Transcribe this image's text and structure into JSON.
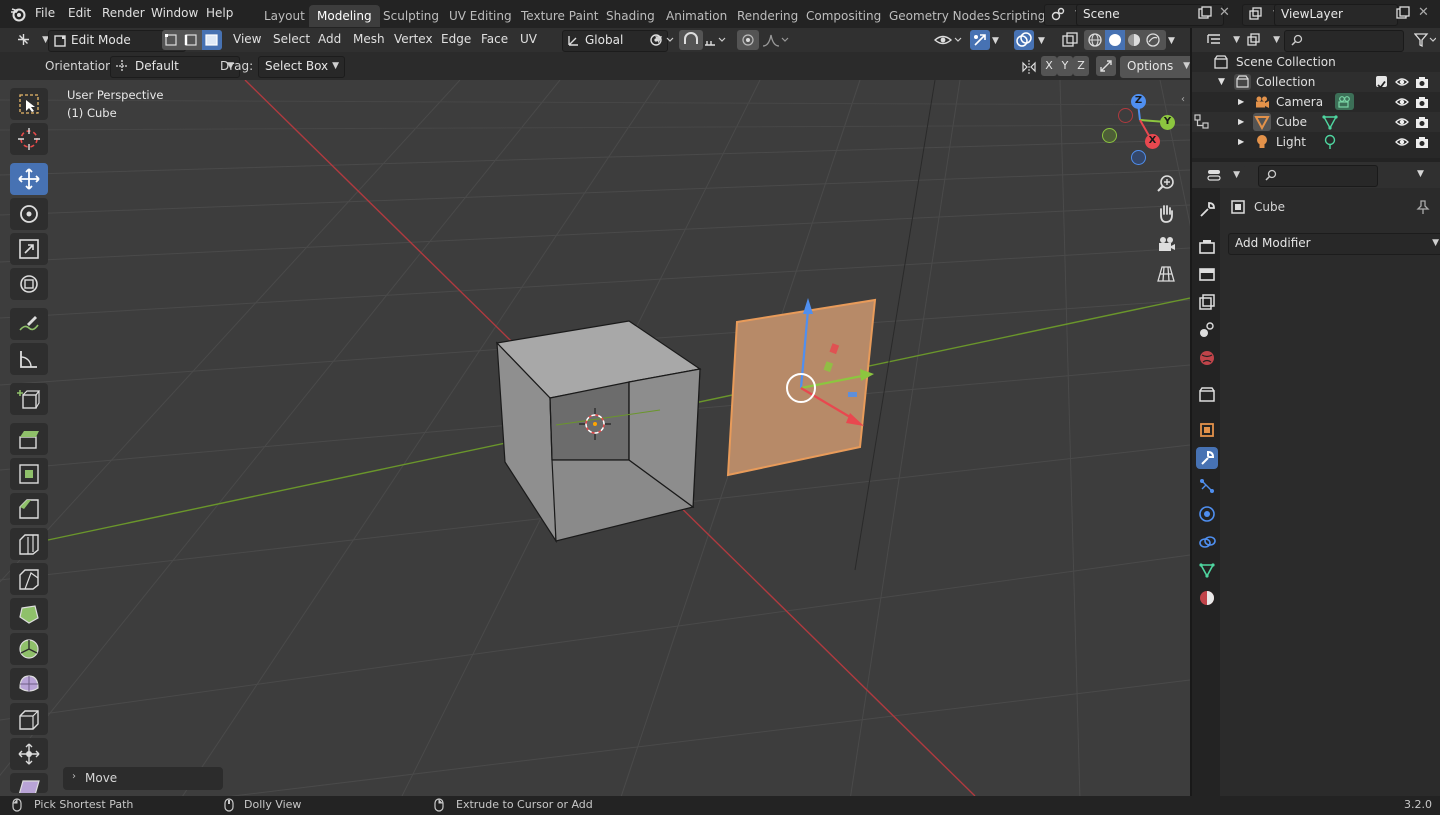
{
  "topbar": {
    "menus": [
      "File",
      "Edit",
      "Render",
      "Window",
      "Help"
    ],
    "workspaces": [
      "Layout",
      "Modeling",
      "Sculpting",
      "UV Editing",
      "Texture Paint",
      "Shading",
      "Animation",
      "Rendering",
      "Compositing",
      "Geometry Nodes",
      "Scripting"
    ],
    "active_workspace": "Modeling",
    "scene_name": "Scene",
    "view_layer": "ViewLayer"
  },
  "viewport_header": {
    "mode": "Edit Mode",
    "menus": [
      "View",
      "Select",
      "Add",
      "Mesh",
      "Vertex",
      "Edge",
      "Face",
      "UV"
    ],
    "transform_orientation": "Global"
  },
  "tool_header": {
    "orientation_label": "Orientation:",
    "orientation_value": "Default",
    "drag_label": "Drag:",
    "drag_value": "Select Box",
    "axis_x": "X",
    "axis_y": "Y",
    "axis_z": "Z",
    "options_label": "Options"
  },
  "viewport": {
    "view_name": "User Perspective",
    "object_label": "(1) Cube",
    "operator_panel": "Move",
    "gizmo": {
      "x": "X",
      "y": "Y",
      "z": "Z"
    }
  },
  "outliner": {
    "scene_collection": "Scene Collection",
    "collection": "Collection",
    "items": [
      {
        "name": "Camera",
        "icon": "camera-icon"
      },
      {
        "name": "Cube",
        "icon": "mesh-icon"
      },
      {
        "name": "Light",
        "icon": "light-icon"
      }
    ]
  },
  "properties": {
    "object_name": "Cube",
    "add_modifier": "Add Modifier"
  },
  "statusbar": {
    "left": "Pick Shortest Path",
    "middle": "Dolly View",
    "right_action": "Extrude to Cursor or Add",
    "version": "3.2.0"
  },
  "colors": {
    "accent": "#4772b3",
    "x_axis": "#e8484f",
    "y_axis": "#8cc63f",
    "z_axis": "#4f8ff0",
    "selection": "#e89b5a"
  }
}
